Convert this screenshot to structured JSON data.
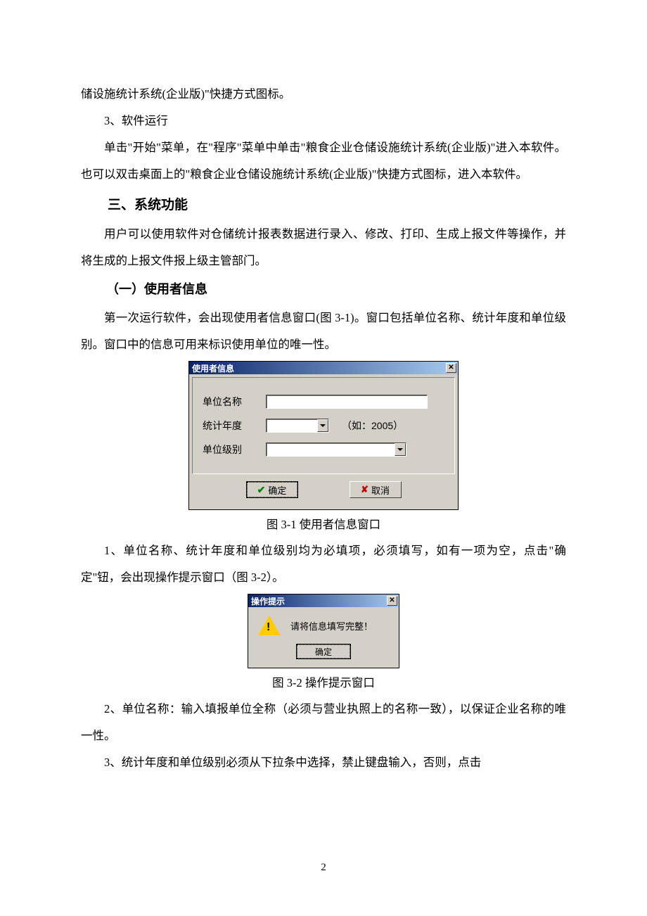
{
  "text": {
    "p0": "储设施统计系统(企业版)\"快捷方式图标。",
    "p1": "3、软件运行",
    "p2": "单击\"开始\"菜单，在\"程序\"菜单中单击\"粮食企业仓储设施统计系统(企业版)\"进入本软件。也可以双击桌面上的\"粮食企业仓储设施统计系统(企业版)\"快捷方式图标，进入本软件。",
    "h2": "三、系统功能",
    "p3": "用户可以使用软件对仓储统计报表数据进行录入、修改、打印、生成上报文件等操作，并将生成的上报文件报上级主管部门。",
    "h3": "（一）使用者信息",
    "p4": "第一次运行软件，会出现使用者信息窗口(图 3-1)。窗口包括单位名称、统计年度和单位级别。窗口中的信息可用来标识使用单位的唯一性。",
    "cap1": "图 3-1 使用者信息窗口",
    "p5": "1、单位名称、统计年度和单位级别均为必填项，必须填写，如有一项为空，点击\"确定\"钮，会出现操作提示窗口（图 3-2）。",
    "cap2": "图 3-2 操作提示窗口",
    "p6": "2、单位名称：输入填报单位全称（必须与营业执照上的名称一致），以保证企业名称的唯一性。",
    "p7": "3、统计年度和单位级别必须从下拉条中选择，禁止键盘输入，否则，点击",
    "pagenum": "2"
  },
  "dlg1": {
    "title": "使用者信息",
    "label_unit": "单位名称",
    "label_year": "统计年度",
    "label_level": "单位级别",
    "year_hint": "（如：2005）",
    "ok_mark": "✔",
    "ok_label": "确定",
    "cancel_mark": "✘",
    "cancel_label": "取消"
  },
  "dlg2": {
    "title": "操作提示",
    "message": "请将信息填写完整！",
    "ok_label": "确定"
  }
}
